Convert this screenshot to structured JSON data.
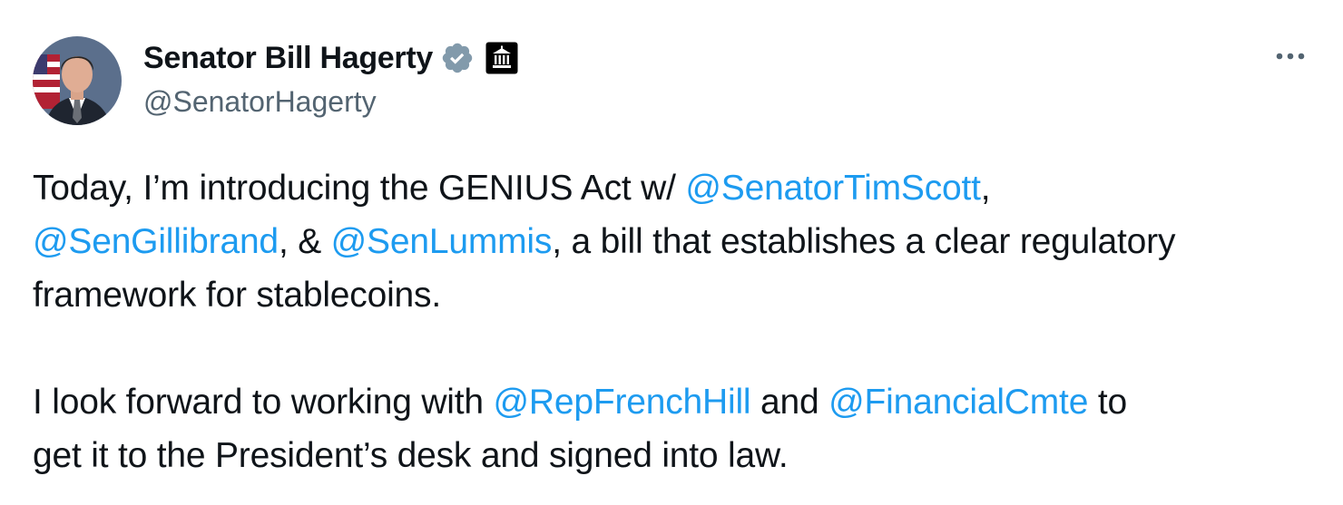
{
  "author": {
    "display_name": "Senator Bill Hagerty",
    "handle": "@SenatorHagerty",
    "verified_icon": "verified-badge-icon",
    "affiliation_icon": "government-building-icon",
    "badge_color": "#829aab"
  },
  "menu": {
    "more_icon": "more-options-icon"
  },
  "tweet": {
    "p1": {
      "l1_a": "Today, I’m introducing the GENIUS Act w/ ",
      "l1_m1": "@SenatorTimScott",
      "l1_b": ",",
      "l2_m1": "@SenGillibrand",
      "l2_a": ", & ",
      "l2_m2": "@SenLummis",
      "l2_b": ", a bill that establishes a clear regulatory",
      "l3_a": "framework for stablecoins."
    },
    "p2": {
      "l1_a": "I look forward to working with ",
      "l1_m1": "@RepFrenchHill",
      "l1_b": " and ",
      "l1_m2": "@FinancialCmte",
      "l1_c": " to",
      "l2_a": "get it to the President’s desk and signed into law."
    }
  },
  "colors": {
    "text": "#0f1419",
    "secondary": "#536471",
    "link": "#1d9bf0"
  }
}
